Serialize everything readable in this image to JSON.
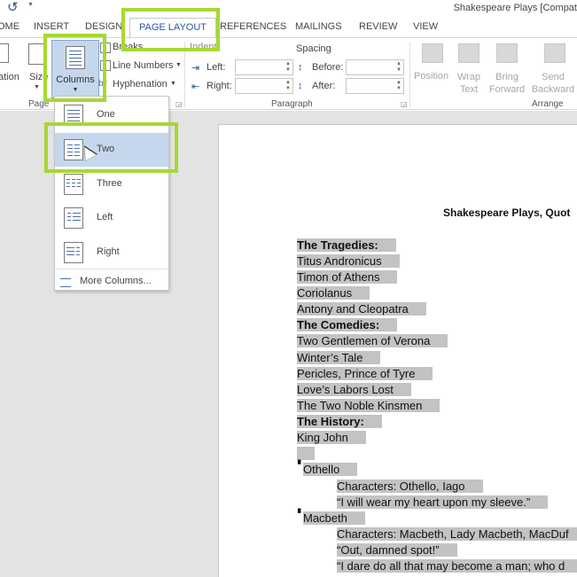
{
  "app": {
    "doc_title": "Shakespeare Plays [Compat"
  },
  "tabs": [
    {
      "label": "OME"
    },
    {
      "label": "INSERT"
    },
    {
      "label": "DESIGN"
    },
    {
      "label": "PAGE LAYOUT"
    },
    {
      "label": "REFERENCES"
    },
    {
      "label": "MAILINGS"
    },
    {
      "label": "REVIEW"
    },
    {
      "label": "VIEW"
    }
  ],
  "ribbon": {
    "orientation_partial": "ation",
    "size_partial": "Size",
    "columns_label": "Columns",
    "breaks_label": "Breaks",
    "line_numbers_label": "Line Numbers",
    "hyphenation_label": "Hyphenation",
    "page_setup_partial": "Page",
    "indent_label": "Indent",
    "left_label": "Left:",
    "right_label": "Right:",
    "spacing_label": "Spacing",
    "before_label": "Before:",
    "after_label": "After:",
    "paragraph_group": "Paragraph",
    "position_label": "Position",
    "wrap_text_label": "Wrap Text",
    "bring_forward_label": "Bring Forward",
    "send_backward_label": "Send Backward",
    "arrange_group": "Arrange"
  },
  "columns_menu": {
    "items": [
      {
        "label": "One"
      },
      {
        "label": "Two"
      },
      {
        "label": "Three"
      },
      {
        "label": "Left"
      },
      {
        "label": "Right"
      }
    ],
    "more": "More Columns..."
  },
  "document": {
    "heading": "Shakespeare Plays, Quot",
    "lines": [
      {
        "text": "The Tragedies:",
        "bold": true
      },
      {
        "text": "Titus Andronicus",
        "bold": false
      },
      {
        "text": "Timon of Athens",
        "bold": false
      },
      {
        "text": "Coriolanus",
        "bold": false
      },
      {
        "text": "Antony and Cleopatra",
        "bold": false
      },
      {
        "text": "The Comedies:",
        "bold": true
      },
      {
        "text": "Two Gentlemen of Verona",
        "bold": false
      },
      {
        "text": "Winter’s Tale",
        "bold": false
      },
      {
        "text": "Pericles, Prince of Tyre",
        "bold": false
      },
      {
        "text": "Love’s Labors Lost",
        "bold": false
      },
      {
        "text": "The Two Noble Kinsmen",
        "bold": false
      },
      {
        "text": "The History:",
        "bold": true
      },
      {
        "text": "King John",
        "bold": false
      },
      {
        "text": "",
        "bold": false
      },
      {
        "text": "Othello",
        "bold": false
      },
      {
        "text": "Characters: Othello, Iago",
        "bold": false
      },
      {
        "text": "“I will wear my heart upon my sleeve.”",
        "bold": false
      },
      {
        "text": "Macbeth",
        "bold": false
      },
      {
        "text": "Characters: Macbeth, Lady Macbeth, MacDuf",
        "bold": false
      },
      {
        "text": "“Out, damned spot!”",
        "bold": false
      },
      {
        "text": "“I dare do all that may become a man; who d",
        "bold": false
      }
    ]
  },
  "colors": {
    "accent": "#2b579a",
    "highlight": "#a6d833",
    "selection": "#c3c3c3",
    "hover": "#c5d7ec"
  }
}
